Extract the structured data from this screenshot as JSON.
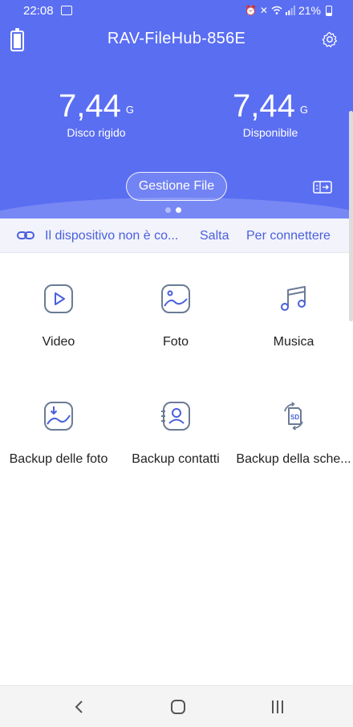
{
  "status_bar": {
    "time": "22:08",
    "battery_percent": "21%"
  },
  "header": {
    "title": "RAV-FileHub-856E",
    "stats": [
      {
        "value": "7,44",
        "unit": "G",
        "label": "Disco rigido"
      },
      {
        "value": "7,44",
        "unit": "G",
        "label": "Disponibile"
      }
    ],
    "manage_button": "Gestione File",
    "page_dots": {
      "count": 2,
      "active": 1
    }
  },
  "connection": {
    "message": "Il dispositivo non è co...",
    "skip_label": "Salta",
    "connect_label": "Per connettere"
  },
  "grid": {
    "items": [
      {
        "label": "Video",
        "icon": "video-play-icon"
      },
      {
        "label": "Foto",
        "icon": "photo-icon"
      },
      {
        "label": "Musica",
        "icon": "music-note-icon"
      },
      {
        "label": "Backup delle foto",
        "icon": "photo-backup-icon"
      },
      {
        "label": "Backup contatti",
        "icon": "contacts-backup-icon"
      },
      {
        "label": "Backup della sche...",
        "icon": "sd-card-backup-icon"
      }
    ]
  },
  "colors": {
    "header_bg": "#5a6ef2",
    "accent": "#4a5fdc",
    "icon_stroke": "#6b7b95"
  }
}
